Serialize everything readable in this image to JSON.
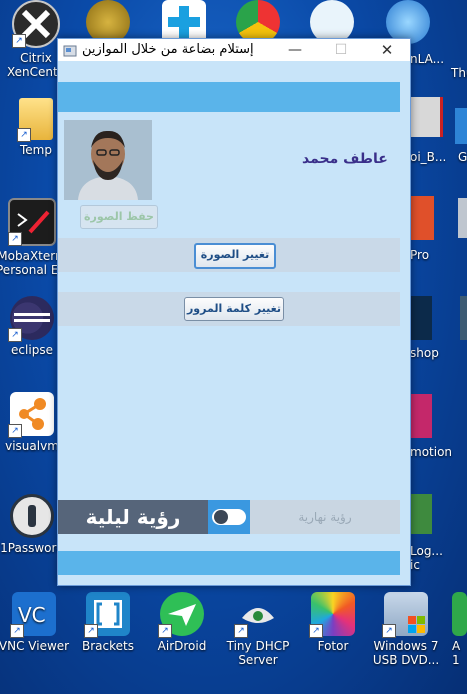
{
  "desktop": {
    "icons": [
      {
        "label": "Citrix XenCenter",
        "line1": "Citrix",
        "line2": "XenCente"
      },
      {
        "label": "Temp",
        "line1": "Temp",
        "line2": ""
      },
      {
        "label": "MobaXterm Personal Edition",
        "line1": "MobaXterm",
        "line2": "Personal E..."
      },
      {
        "label": "eclipse",
        "line1": "eclipse",
        "line2": ""
      },
      {
        "label": "visualvm",
        "line1": "visualvm",
        "line2": ""
      },
      {
        "label": "1Password",
        "line1": "1Password",
        "line2": ""
      },
      {
        "label": "VNC Viewer",
        "line1": "VNC Viewer",
        "line2": ""
      },
      {
        "label": "Brackets",
        "line1": "Brackets",
        "line2": ""
      },
      {
        "label": "AirDroid",
        "line1": "AirDroid",
        "line2": ""
      },
      {
        "label": "Tiny DHCP Server",
        "line1": "Tiny DHCP",
        "line2": "Server"
      },
      {
        "label": "Fotor",
        "line1": "Fotor",
        "line2": ""
      },
      {
        "label": "Windows 7 USB DVD...",
        "line1": "Windows 7",
        "line2": "USB DVD..."
      },
      {
        "label": "A",
        "line1": "A",
        "line2": "1"
      }
    ],
    "right_partial_labels": [
      "nLA...",
      "Thu",
      "oi_B...",
      "G",
      "Pro",
      "shop",
      "motion",
      "Log...",
      "ic"
    ]
  },
  "window": {
    "title": "إستلام بضاعة من خلال الموازين",
    "minimize": "—",
    "maximize": "☐",
    "close": "✕"
  },
  "profile": {
    "user_name": "عاطف محمد",
    "save_photo": "حفظ الصورة",
    "change_photo": "تغيير الصورة",
    "change_password": "تغيير كلمة المرور"
  },
  "theme": {
    "night_label": "رؤية ليلية",
    "day_label": "رؤية نهارية",
    "night_enabled": false
  },
  "colors": {
    "accent": "#5ab4ea",
    "client_bg": "#c8e4f9",
    "name_color": "#3a2f8a"
  }
}
